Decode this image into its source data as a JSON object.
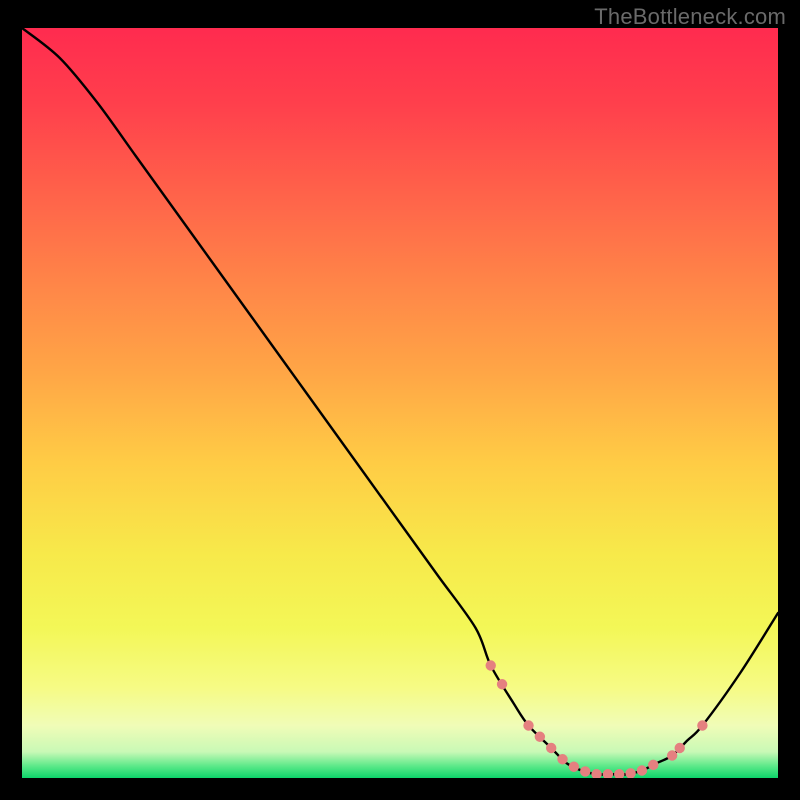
{
  "attribution": "TheBottleneck.com",
  "chart_data": {
    "type": "line",
    "title": "",
    "xlabel": "",
    "ylabel": "",
    "xlim": [
      0,
      100
    ],
    "ylim": [
      0,
      100
    ],
    "grid": false,
    "legend": false,
    "x": [
      0,
      5,
      10,
      15,
      20,
      25,
      30,
      35,
      40,
      45,
      50,
      55,
      60,
      62,
      65,
      67,
      70,
      72,
      74,
      76,
      78,
      80,
      82,
      84,
      86,
      88,
      90,
      95,
      100
    ],
    "values": [
      100,
      96,
      90,
      83,
      76,
      69,
      62,
      55,
      48,
      41,
      34,
      27,
      20,
      15,
      10,
      7,
      4,
      2,
      1,
      0.5,
      0.5,
      0.5,
      1,
      2,
      3,
      5,
      7,
      14,
      22
    ],
    "gradient_stops": [
      {
        "offset": 0.0,
        "color": "#ff2b4f"
      },
      {
        "offset": 0.1,
        "color": "#ff3f4c"
      },
      {
        "offset": 0.22,
        "color": "#ff624a"
      },
      {
        "offset": 0.34,
        "color": "#ff8548"
      },
      {
        "offset": 0.46,
        "color": "#ffa646"
      },
      {
        "offset": 0.58,
        "color": "#ffcc45"
      },
      {
        "offset": 0.7,
        "color": "#f7e94a"
      },
      {
        "offset": 0.8,
        "color": "#f3f757"
      },
      {
        "offset": 0.88,
        "color": "#f6fb85"
      },
      {
        "offset": 0.93,
        "color": "#f0fcb7"
      },
      {
        "offset": 0.965,
        "color": "#c9f9b6"
      },
      {
        "offset": 0.985,
        "color": "#57e887"
      },
      {
        "offset": 1.0,
        "color": "#0dd36a"
      }
    ],
    "curve_stroke": "#000000",
    "curve_stroke_width": 2.4,
    "dots": {
      "color": "#e58080",
      "radius": 5.2,
      "positions_x": [
        62,
        63.5,
        67,
        68.5,
        70,
        71.5,
        73,
        74.5,
        76,
        77.5,
        79,
        80.5,
        82,
        83.5,
        86,
        87,
        90
      ]
    }
  }
}
